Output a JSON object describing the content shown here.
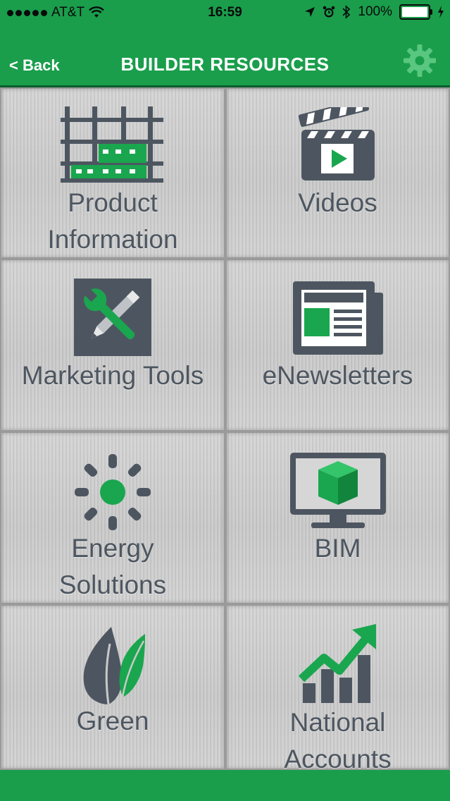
{
  "status_bar": {
    "carrier": "AT&T",
    "time": "16:59",
    "battery": "100%"
  },
  "nav": {
    "back_label": "< Back",
    "title": "BUILDER RESOURCES",
    "settings_icon": "gear-icon"
  },
  "tiles": [
    {
      "line1": "Product",
      "line2": "Information",
      "icon": "product-grid-icon"
    },
    {
      "line1": "Videos",
      "line2": "",
      "icon": "clapperboard-icon"
    },
    {
      "line1": "Marketing Tools",
      "line2": "",
      "icon": "wrench-pencil-icon"
    },
    {
      "line1": "eNewsletters",
      "line2": "",
      "icon": "newspaper-icon"
    },
    {
      "line1": "Energy",
      "line2": "Solutions",
      "icon": "sun-icon"
    },
    {
      "line1": "BIM",
      "line2": "",
      "icon": "monitor-cube-icon"
    },
    {
      "line1": "Green",
      "line2": "",
      "icon": "leaf-icon"
    },
    {
      "line1": "National",
      "line2": "Accounts",
      "icon": "growth-chart-icon"
    }
  ],
  "colors": {
    "brand_green": "#1a9e4c",
    "icon_green": "#1aa64e",
    "icon_slate": "#4d5660",
    "tile_gray": "#cbcbcb"
  }
}
